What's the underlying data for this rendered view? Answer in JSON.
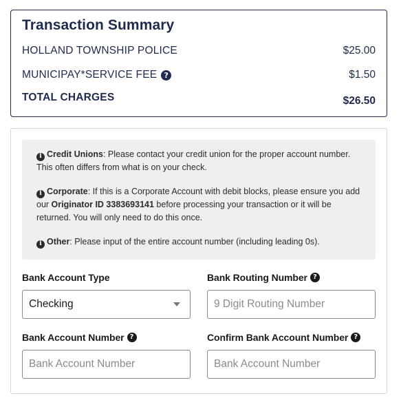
{
  "summary": {
    "title": "Transaction Summary",
    "rows": [
      {
        "label": "HOLLAND TOWNSHIP POLICE",
        "amount": "$25.00"
      },
      {
        "label": "MUNICIPAY*SERVICE FEE",
        "amount": "$1.50"
      },
      {
        "label": "TOTAL CHARGES",
        "amount": "$26.50"
      }
    ]
  },
  "notice": {
    "credit_title": "Credit Unions",
    "credit_text": ": Please contact your credit union for the proper account number. This often differs from what is on your check.",
    "corp_title": "Corporate",
    "corp_text1": ": If this is a Corporate Account with debit blocks, please ensure you add our ",
    "corp_originator": "Originator ID 3383693141",
    "corp_text2": " before processing your transaction or it will be returned. You will only need to do this once.",
    "other_title": "Other",
    "other_text": ": Please input of the entire account number (including leading 0s)."
  },
  "form": {
    "account_type_label": "Bank Account Type",
    "account_type_value": "Checking",
    "routing_label": "Bank Routing Number",
    "routing_placeholder": "9 Digit Routing Number",
    "account_number_label": "Bank Account Number",
    "account_number_placeholder": "Bank Account Number",
    "confirm_label": "Confirm Bank Account Number",
    "confirm_placeholder": "Bank Account Number"
  },
  "icons": {
    "help": "question-circle-icon",
    "info": "info-circle-icon",
    "dropdown": "chevron-down-icon"
  },
  "colors": {
    "brand_navy": "#1f2a4d",
    "notice_bg": "#efefef",
    "input_border": "#8a8a8a"
  }
}
